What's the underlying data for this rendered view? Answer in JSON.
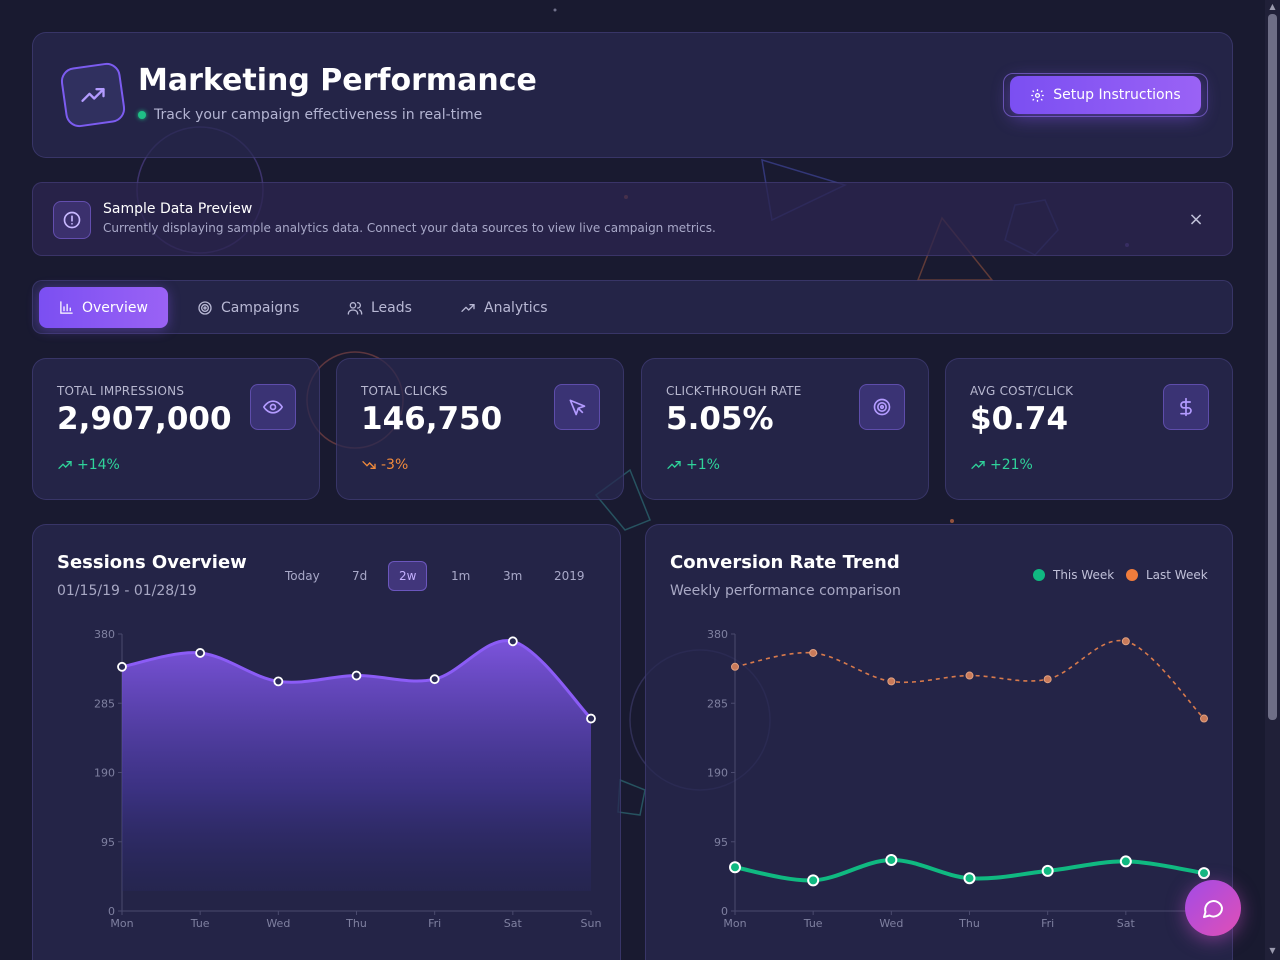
{
  "header": {
    "title": "Marketing Performance",
    "subtitle": "Track your campaign effectiveness in real-time",
    "setup_label": "Setup Instructions"
  },
  "banner": {
    "title": "Sample Data Preview",
    "text": "Currently displaying sample analytics data. Connect your data sources to view live campaign metrics.",
    "close": "×"
  },
  "tabs": [
    {
      "label": "Overview",
      "icon": "bar-chart-icon",
      "active": true
    },
    {
      "label": "Campaigns",
      "icon": "target-icon",
      "active": false
    },
    {
      "label": "Leads",
      "icon": "users-icon",
      "active": false
    },
    {
      "label": "Analytics",
      "icon": "trending-up-icon",
      "active": false
    }
  ],
  "stats": [
    {
      "label": "TOTAL IMPRESSIONS",
      "value": "2,907,000",
      "change": "+14%",
      "trend": "up",
      "icon": "eye-icon"
    },
    {
      "label": "TOTAL CLICKS",
      "value": "146,750",
      "change": "-3%",
      "trend": "down",
      "icon": "cursor-icon"
    },
    {
      "label": "CLICK-THROUGH RATE",
      "value": "5.05%",
      "change": "+1%",
      "trend": "up",
      "icon": "target-icon"
    },
    {
      "label": "AVG COST/CLICK",
      "value": "$0.74",
      "change": "+21%",
      "trend": "up",
      "icon": "dollar-icon"
    }
  ],
  "sessions": {
    "title": "Sessions Overview",
    "date_range": "01/15/19 - 01/28/19",
    "ranges": [
      "Today",
      "7d",
      "2w",
      "1m",
      "3m",
      "2019"
    ],
    "active_range": "2w"
  },
  "conversion": {
    "title": "Conversion Rate Trend",
    "subtitle": "Weekly performance comparison",
    "legend": [
      "This Week",
      "Last Week"
    ]
  },
  "colors": {
    "accent": "#8b5cf6",
    "this_week": "#10b981",
    "last_week": "#f07c3c",
    "positive": "#2fd39a",
    "negative": "#f08a3c"
  },
  "chart_data": [
    {
      "type": "area",
      "title": "Sessions Overview",
      "categories": [
        "Mon",
        "Tue",
        "Wed",
        "Thu",
        "Fri",
        "Sat",
        "Sun"
      ],
      "series": [
        {
          "values": [
            335,
            354,
            315,
            323,
            318,
            370,
            264
          ]
        }
      ],
      "ylim": [
        0,
        380
      ],
      "yticks": [
        0,
        95,
        190,
        285,
        380
      ],
      "grid": false
    },
    {
      "type": "line",
      "title": "Conversion Rate Trend",
      "categories": [
        "Mon",
        "Tue",
        "Wed",
        "Thu",
        "Fri",
        "Sat",
        "Sun"
      ],
      "series": [
        {
          "name": "This Week",
          "values": [
            60,
            42,
            70,
            45,
            55,
            68,
            52
          ]
        },
        {
          "name": "Last Week",
          "values": [
            335,
            354,
            315,
            323,
            318,
            370,
            264
          ]
        }
      ],
      "ylim": [
        0,
        380
      ],
      "yticks": [
        0,
        95,
        190,
        285,
        380
      ],
      "legend": "top-right",
      "grid": false
    }
  ]
}
